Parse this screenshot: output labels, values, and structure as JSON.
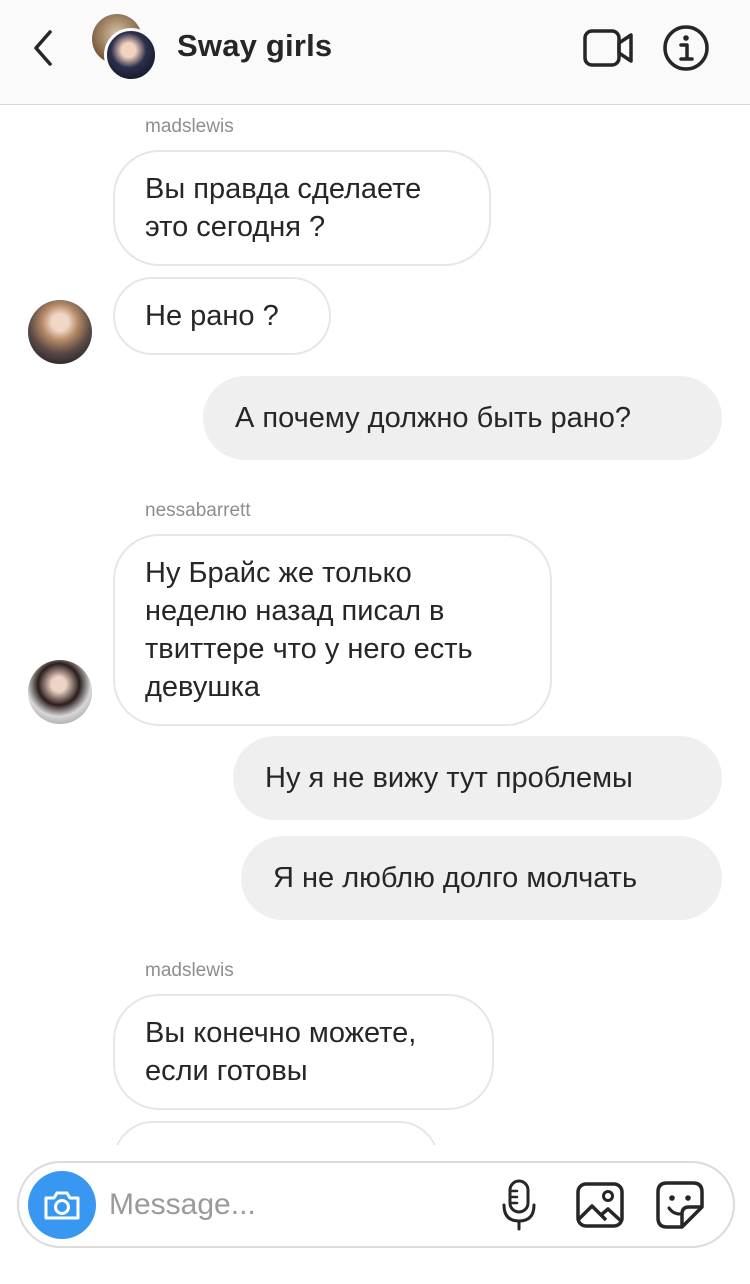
{
  "header": {
    "title": "Sway girls"
  },
  "messages": [
    {
      "sender": "madslewis",
      "text": "Вы правда сделаете это сегодня ?",
      "lines": [
        "Вы правда сделаете",
        "это сегодня ?"
      ]
    },
    {
      "sender": "madslewis",
      "text": "Не рано ?"
    },
    {
      "sender": "me",
      "text": "А почему должно быть рано?"
    },
    {
      "sender": "nessabarrett",
      "text": "Ну Брайс же только неделю назад писал в твиттере что у него есть девушка",
      "lines": [
        "Ну Брайс же только",
        "неделю назад писал в",
        "твиттере что у него есть",
        "девушка"
      ]
    },
    {
      "sender": "me",
      "text": "Ну я не вижу тут проблемы"
    },
    {
      "sender": "me",
      "text": "Я не люблю долго молчать"
    },
    {
      "sender": "madslewis",
      "text": "Вы конечно можете, если готовы",
      "lines": [
        "Вы конечно можете,",
        "если готовы"
      ]
    }
  ],
  "composer": {
    "placeholder": "Message..."
  },
  "icons": {
    "back": "chevron-left-icon",
    "video": "video-camera-icon",
    "info": "info-icon",
    "camera": "camera-icon",
    "mic": "microphone-icon",
    "gallery": "image-icon",
    "sticker": "sticker-icon"
  },
  "colors": {
    "accent": "#3897f0",
    "outgoing_bubble": "#efefef",
    "incoming_border": "#e6e6e6",
    "meta_text": "#8e8e8e"
  }
}
